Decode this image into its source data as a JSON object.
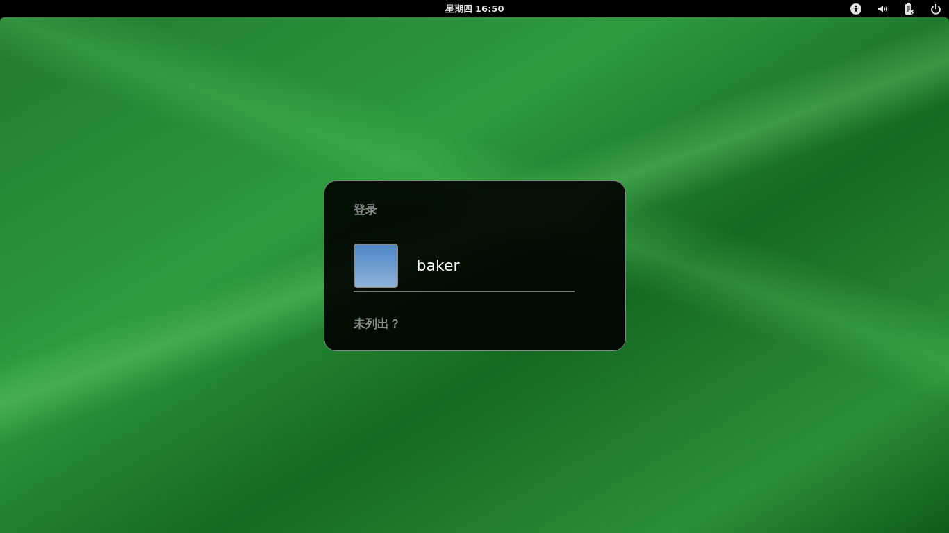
{
  "top_bar": {
    "clock": "星期四 16:50"
  },
  "login_dialog": {
    "title": "登录",
    "users": [
      {
        "name": "baker",
        "selected": false
      }
    ],
    "not_listed": "未列出？"
  }
}
